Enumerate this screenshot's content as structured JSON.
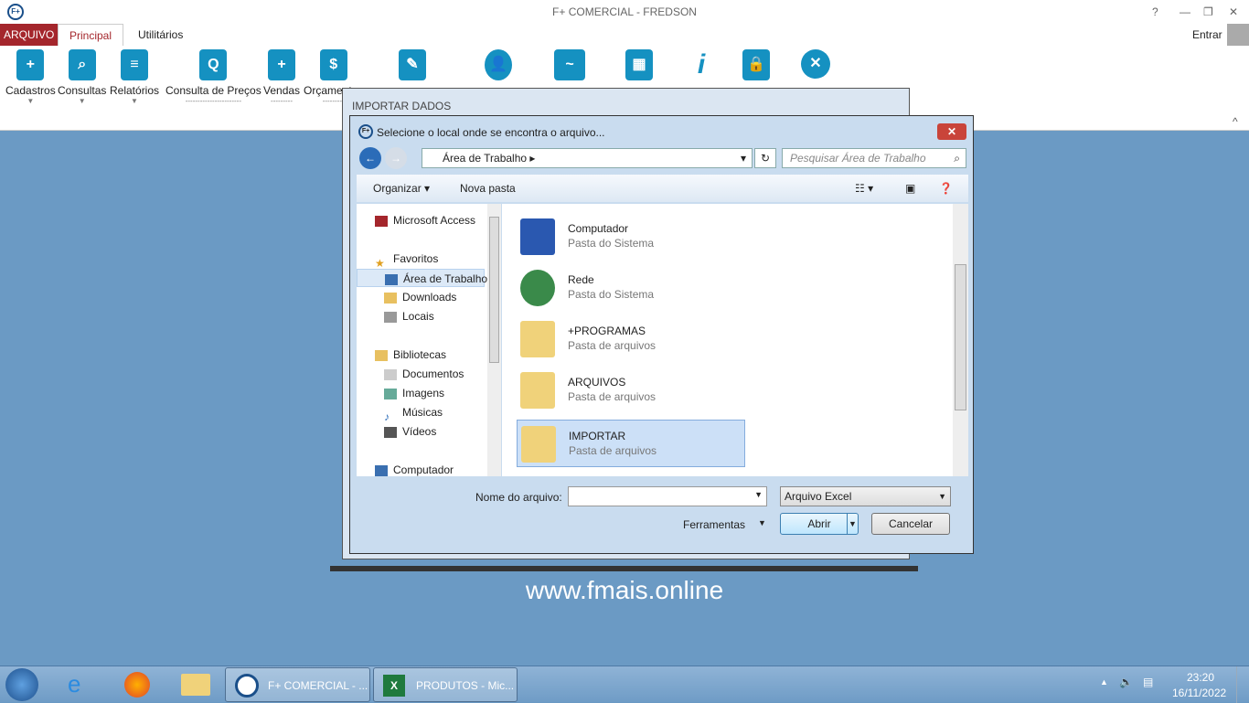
{
  "window": {
    "title": "F+ COMERCIAL - FREDSON",
    "help": "?",
    "login": "Entrar"
  },
  "ribbon": {
    "tabs": [
      "ARQUIVO",
      "Principal",
      "Utilitários"
    ],
    "buttons": [
      {
        "label": "Cadastros",
        "icon": "document-add-icon"
      },
      {
        "label": "Consultas",
        "icon": "document-search-icon"
      },
      {
        "label": "Relatórios",
        "icon": "report-icon"
      },
      {
        "label": "Consulta de Preços",
        "icon": "monitor-search-icon"
      },
      {
        "label": "Vendas",
        "icon": "basket-icon"
      },
      {
        "label": "Orçamentos",
        "icon": "calculator-icon"
      },
      {
        "label": "",
        "icon": "service-order-icon"
      },
      {
        "label": "",
        "icon": "admin-user-icon"
      },
      {
        "label": "",
        "icon": "chart-monitor-icon"
      },
      {
        "label": "",
        "icon": "cash-register-icon"
      },
      {
        "label": "",
        "icon": "info-icon"
      },
      {
        "label": "",
        "icon": "user-lock-icon"
      },
      {
        "label": "",
        "icon": "close-circle-icon"
      }
    ]
  },
  "importar": {
    "title": "IMPORTAR DADOS"
  },
  "dialog": {
    "title": "Selecione o local onde se encontra o arquivo...",
    "path": "Área de Trabalho",
    "search_placeholder": "Pesquisar Área de Trabalho",
    "organize": "Organizar ▾",
    "new_folder": "Nova pasta",
    "tree": [
      {
        "label": "Microsoft Access",
        "indent": 0
      },
      {
        "label": "Favoritos",
        "indent": 0
      },
      {
        "label": "Área de Trabalho",
        "indent": 1,
        "selected": true
      },
      {
        "label": "Downloads",
        "indent": 1
      },
      {
        "label": "Locais",
        "indent": 1
      },
      {
        "label": "Bibliotecas",
        "indent": 0
      },
      {
        "label": "Documentos",
        "indent": 1
      },
      {
        "label": "Imagens",
        "indent": 1
      },
      {
        "label": "Músicas",
        "indent": 1
      },
      {
        "label": "Vídeos",
        "indent": 1
      },
      {
        "label": "Computador",
        "indent": 0
      }
    ],
    "files": [
      {
        "name": "Computador",
        "type": "Pasta do Sistema",
        "icon": "computer-icon"
      },
      {
        "name": "Rede",
        "type": "Pasta do Sistema",
        "icon": "network-icon"
      },
      {
        "name": "+PROGRAMAS",
        "type": "Pasta de arquivos",
        "icon": "folder-icon"
      },
      {
        "name": "ARQUIVOS",
        "type": "Pasta de arquivos",
        "icon": "folder-icon"
      },
      {
        "name": "IMPORTAR",
        "type": "Pasta de arquivos",
        "icon": "folder-icon",
        "selected": true
      }
    ],
    "filename_label": "Nome do arquivo:",
    "filename_value": "",
    "filetype": "Arquivo Excel",
    "tools": "Ferramentas",
    "open": "Abrir",
    "cancel": "Cancelar"
  },
  "website": "www.fmais.online",
  "taskbar": {
    "items": [
      "F+ COMERCIAL - ...",
      "PRODUTOS - Mic..."
    ],
    "time": "23:20",
    "date": "16/11/2022"
  }
}
